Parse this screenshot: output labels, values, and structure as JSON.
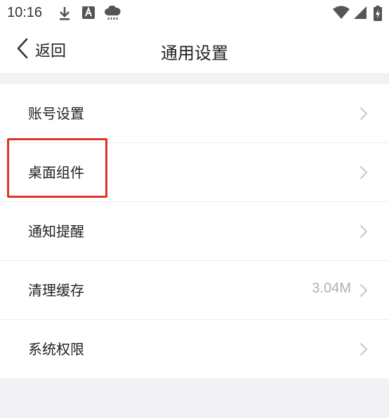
{
  "status_bar": {
    "time": "10:16",
    "left_icons": [
      "download-icon",
      "font-a-icon",
      "cloud-rain-icon"
    ],
    "right_icons": [
      "wifi-icon",
      "signal-icon",
      "battery-charging-icon"
    ]
  },
  "nav": {
    "back_label": "返回",
    "title": "通用设置"
  },
  "settings": {
    "items": [
      {
        "label": "账号设置",
        "value": ""
      },
      {
        "label": "桌面组件",
        "value": ""
      },
      {
        "label": "通知提醒",
        "value": ""
      },
      {
        "label": "清理缓存",
        "value": "3.04M"
      },
      {
        "label": "系统权限",
        "value": ""
      }
    ]
  },
  "colors": {
    "highlight": "#e0342b",
    "background": "#f2f2f4",
    "chevron": "#c8c8cc"
  }
}
